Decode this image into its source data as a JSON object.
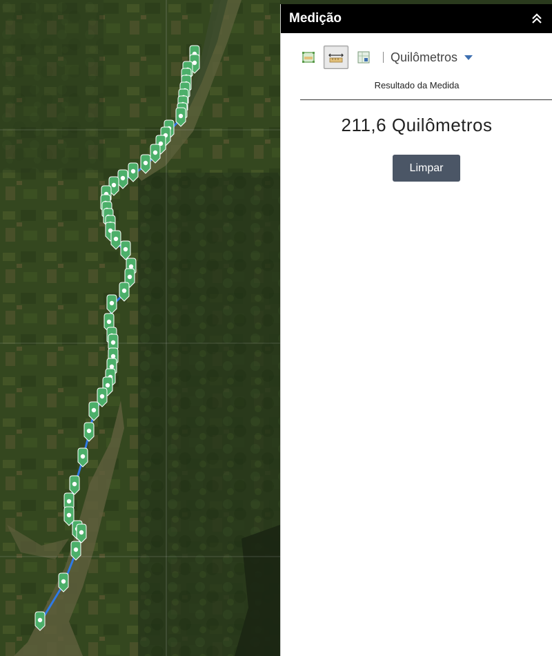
{
  "panel": {
    "title": "Medição",
    "unit": "Quilômetros",
    "result_label": "Resultado da Medida",
    "result_value": "211,6 Quilômetros",
    "clear_label": "Limpar"
  },
  "icons": {
    "collapse": "double-chevron-up-icon",
    "area_tool": "area-measure-icon",
    "distance_tool": "distance-measure-icon",
    "location_tool": "location-measure-icon",
    "unit_dropdown": "caret-down-icon",
    "map_marker": "map-pin-icon"
  },
  "colors": {
    "marker": "#4caf6a",
    "route_line": "#2f7ae5",
    "button": "#4b5666",
    "header": "#000000"
  }
}
